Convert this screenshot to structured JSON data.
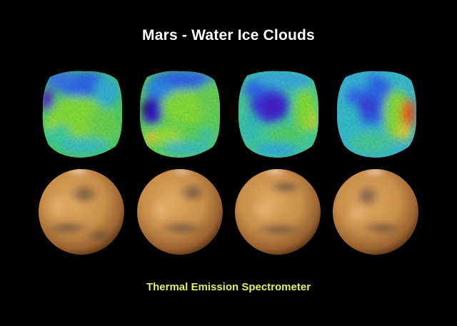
{
  "title": "Mars - Water Ice Clouds",
  "caption": "Thermal Emission Spectrometer",
  "colors": {
    "background": "#000000",
    "title": "#ffffff",
    "caption": "#d9f55a",
    "mars_surface": "#c98e4a",
    "cloud_map_palette": [
      "#3a1bd8",
      "#2f6cf2",
      "#33c3e6",
      "#52e07a",
      "#8ae63a",
      "#e8d640",
      "#f05a24"
    ]
  },
  "panels": [
    {
      "cloud_map": "cloud-map-1",
      "globe": "mars-globe-1"
    },
    {
      "cloud_map": "cloud-map-2",
      "globe": "mars-globe-2"
    },
    {
      "cloud_map": "cloud-map-3",
      "globe": "mars-globe-3"
    },
    {
      "cloud_map": "cloud-map-4",
      "globe": "mars-globe-4"
    }
  ]
}
